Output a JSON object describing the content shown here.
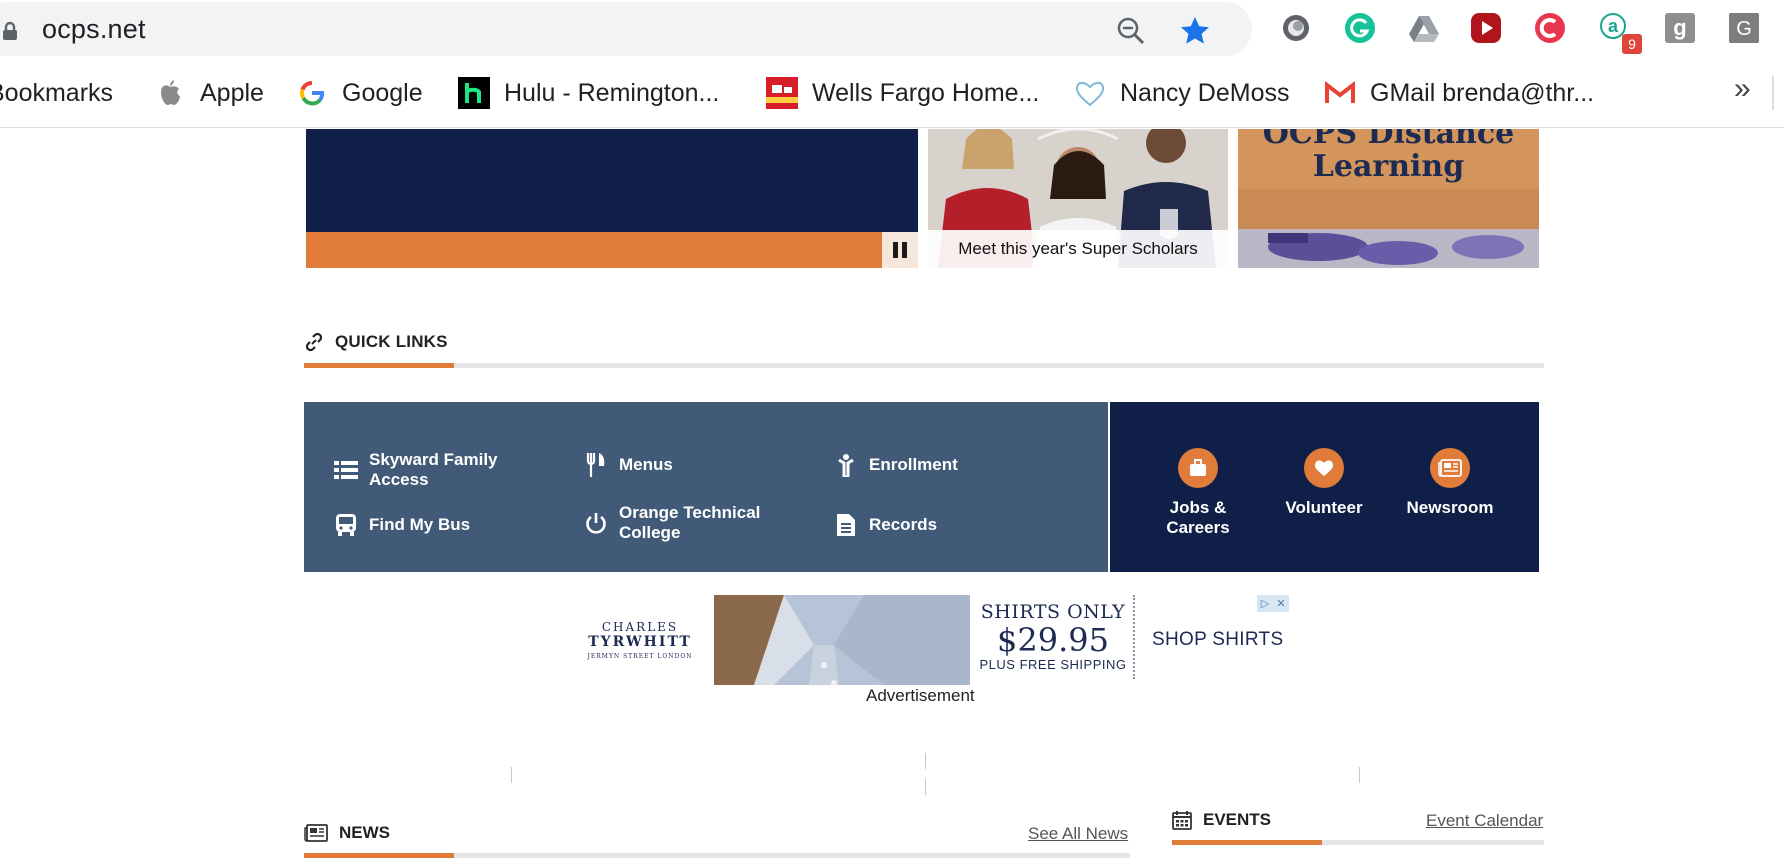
{
  "browser": {
    "url": "ocps.net",
    "extensions": [
      {
        "icon": "extension-circle-icon"
      },
      {
        "icon": "grammarly-icon",
        "color": "#15c39a"
      },
      {
        "icon": "google-drive-icon"
      },
      {
        "icon": "youtube-extension-icon",
        "color": "#c4141c"
      },
      {
        "icon": "red-c-extension-icon",
        "color": "#e8384f"
      },
      {
        "icon": "a-extension-icon",
        "color": "#1aa58f",
        "badge": "9"
      },
      {
        "icon": "g-grey-extension-icon"
      },
      {
        "icon": "g-account-icon"
      }
    ]
  },
  "bookmarks": {
    "items": [
      {
        "label": "Bookmarks",
        "icon": "bookmarks-folder"
      },
      {
        "label": "Apple",
        "icon": "apple-icon"
      },
      {
        "label": "Google",
        "icon": "google-icon"
      },
      {
        "label": "Hulu - Remington...",
        "icon": "hulu-icon"
      },
      {
        "label": "Wells Fargo Home...",
        "icon": "wells-fargo-icon"
      },
      {
        "label": "Nancy DeMoss",
        "icon": "heart-icon"
      },
      {
        "label": "GMail brenda@thr...",
        "icon": "gmail-icon"
      }
    ],
    "more": "»"
  },
  "hero": {
    "scholars_caption": "Meet this year's Super Scholars",
    "distance_title": "OCPS Distance Learning"
  },
  "quick_links": {
    "title": "QUICK LINKS",
    "items": [
      {
        "label": "Skyward Family Access",
        "icon": "list-icon"
      },
      {
        "label": "Menus",
        "icon": "utensils-icon"
      },
      {
        "label": "Enrollment",
        "icon": "child-icon"
      },
      {
        "label": "Find My Bus",
        "icon": "bus-icon"
      },
      {
        "label": "Orange Technical College",
        "icon": "power-icon"
      },
      {
        "label": "Records",
        "icon": "document-icon"
      }
    ],
    "featured": [
      {
        "label": "Jobs & Careers",
        "icon": "briefcase-icon"
      },
      {
        "label": "Volunteer",
        "icon": "heart-icon"
      },
      {
        "label": "Newsroom",
        "icon": "newspaper-icon"
      }
    ]
  },
  "ad": {
    "brand_line1": "CHARLES",
    "brand_line2": "TYRWHITT",
    "brand_line3": "JERMYN STREET LONDON",
    "offer_line1": "SHIRTS ONLY",
    "offer_price": "$29.95",
    "offer_line2": "PLUS FREE SHIPPING",
    "cta": "SHOP SHIRTS",
    "label": "Advertisement"
  },
  "news": {
    "title": "NEWS",
    "see_all": "See All News"
  },
  "events": {
    "title": "EVENTS",
    "calendar_link": "Event Calendar"
  },
  "colors": {
    "navy": "#0f1f47",
    "slate": "#405a78",
    "orange": "#e07b39"
  }
}
